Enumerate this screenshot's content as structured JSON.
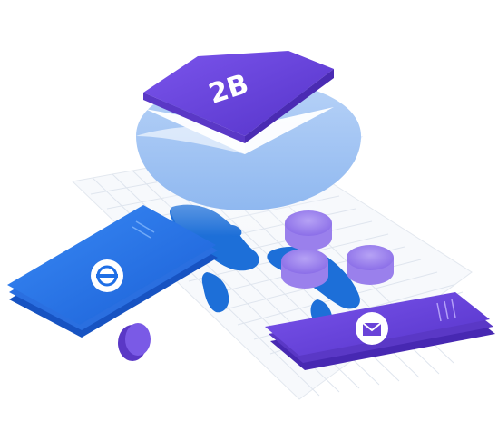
{
  "illustration": {
    "badge_text": "2B",
    "colors": {
      "purple": "#6a43d8",
      "purple_light": "#8a6af0",
      "blue": "#1f6fe6",
      "blue_light": "#a9c8f5",
      "map_blue": "#1d6fd8",
      "grid": "#dde3ec"
    },
    "icons": {
      "left_phone": "edge-logo-icon",
      "right_phone": "send-envelope-icon"
    }
  }
}
